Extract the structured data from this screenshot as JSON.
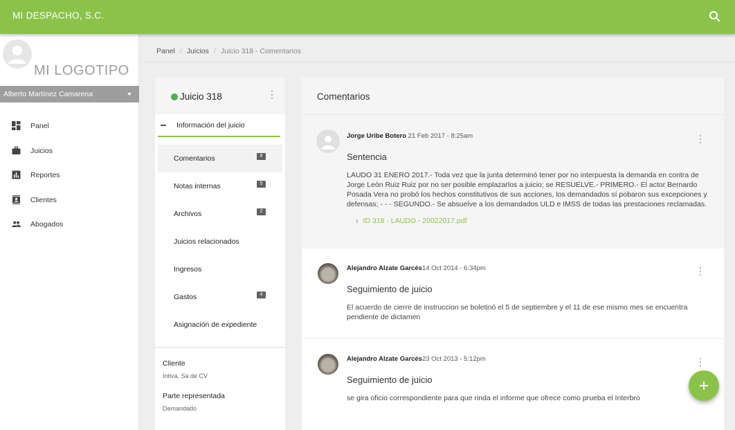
{
  "header": {
    "app_title": "MI DESPACHO, S.C.",
    "search_icon": "search-icon",
    "color": "#8bc34a"
  },
  "sidebar": {
    "logo_text": "MI LOGOTIPO",
    "user_name": "Alberto Martínez Camarena",
    "items": [
      {
        "label": "Panel",
        "icon": "dashboard-icon"
      },
      {
        "label": "Juicios",
        "icon": "briefcase-icon"
      },
      {
        "label": "Reportes",
        "icon": "bar-chart-icon"
      },
      {
        "label": "Clientes",
        "icon": "contact-card-icon"
      },
      {
        "label": "Abogados",
        "icon": "people-icon"
      }
    ]
  },
  "breadcrumb": {
    "items": [
      "Panel",
      "Juicios",
      "Juicio 318 - Comentarios"
    ]
  },
  "trial": {
    "title": "Juicio 318",
    "status_color": "#4caf50",
    "info_label": "Información del juicio",
    "menu": [
      {
        "label": "Comentarios",
        "badge": "8",
        "active": true
      },
      {
        "label": "Notas internas",
        "badge": "5"
      },
      {
        "label": "Archivos",
        "badge": "2"
      },
      {
        "label": "Juicios relacionados",
        "badge": ""
      },
      {
        "label": "Ingresos",
        "badge": ""
      },
      {
        "label": "Gastos",
        "badge": "4"
      },
      {
        "label": "Asignación de expediente",
        "badge": ""
      }
    ],
    "client_label": "Cliente",
    "client_value": "Intiva, Sa de CV",
    "party_label": "Parte representada",
    "party_value": "Demandado"
  },
  "comments": {
    "title": "Comentarios",
    "items": [
      {
        "author": "Jorge Uribe Botero",
        "date": " 21 Feb 2017 - 8:25am",
        "subject": "Sentencia",
        "body": "LAUDO 31 ENERO 2017.- Toda vez que la junta determinó tener por no interpuesta la demanda en contra de Jorge León Ruiz Ruiz por no ser posible emplazarlos a juicio; se RESUELVE.- PRIMERO.- El actor Bernardo Posada Vera no probó los hechos constitutivos de sus acciones, los demandados sí pobaron sus excepciones y defensas; - - - SEGUNDO.- Se absuelve a los demandados ULD e IMSS de todas las prestaciones reclamadas.",
        "attachment": "ID 318 - LAUDO - 20022017.pdf"
      },
      {
        "author": "Alejandro Alzate Garcés",
        "date": "14 Oct 2014 - 6:34pm",
        "subject": "Seguimiento de juicio",
        "body": "El acuerdo de cierre de instruccion se boletinó el 5 de septiembre y el 11 de ese mismo mes se encuentra pendiente de dictamen"
      },
      {
        "author": "Alejandro Alzate Garcés",
        "date": "23 Oct 2013 - 5:12pm",
        "subject": "Seguimiento de juicio",
        "body": "se gira oficio correspondiente para que rinda el informe que ofrece como prueba el Interbro"
      }
    ]
  },
  "fab": {
    "icon": "plus-icon"
  }
}
